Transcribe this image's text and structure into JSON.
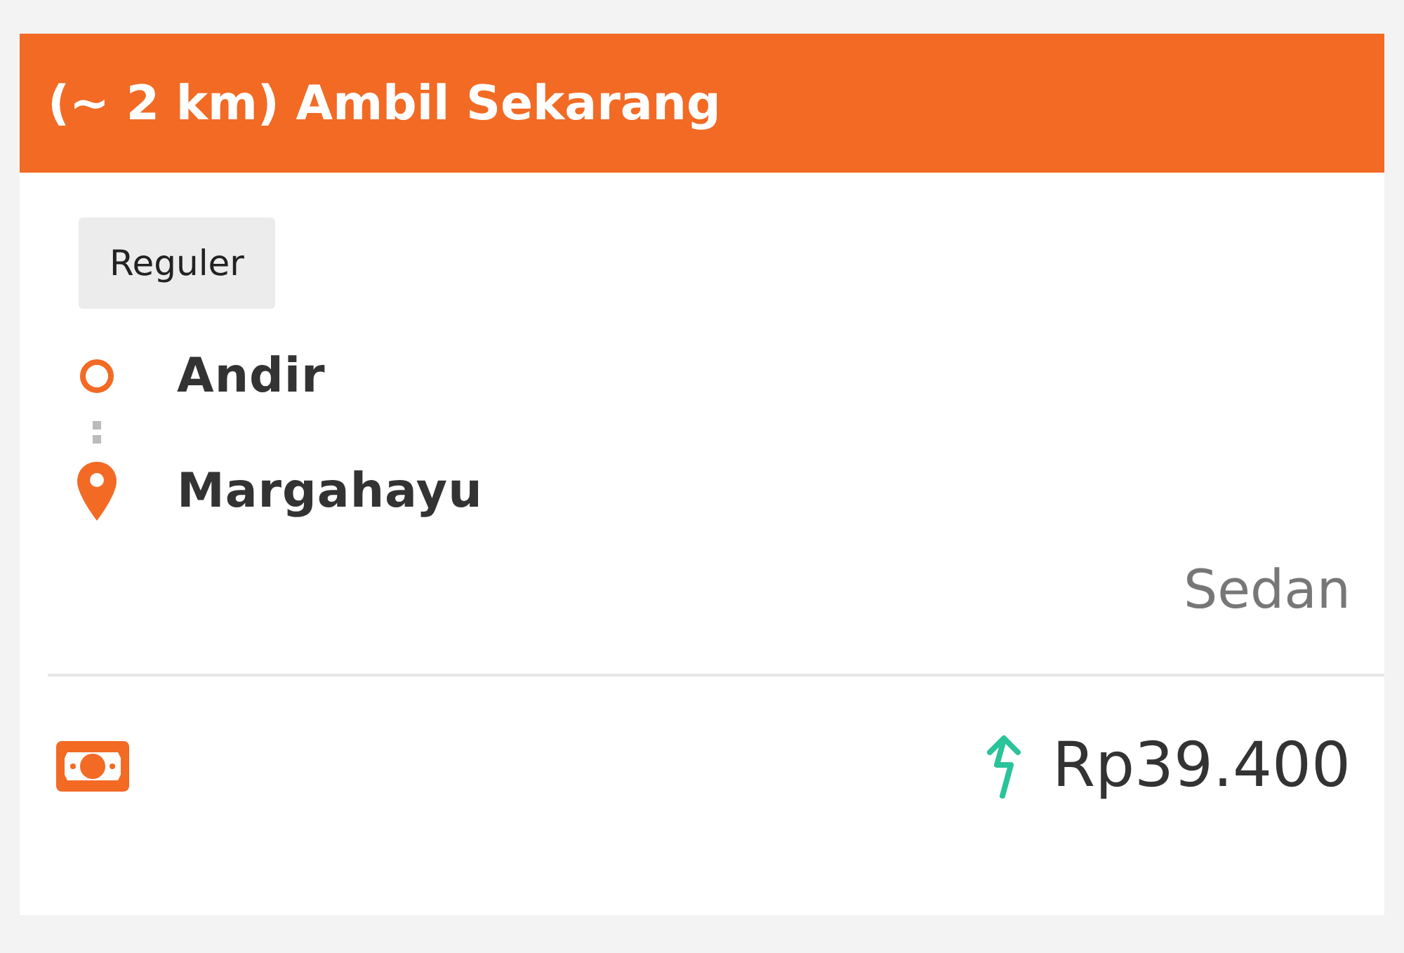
{
  "header": {
    "title": "(~ 2 km) Ambil Sekarang"
  },
  "service_tag": "Reguler",
  "route": [
    {
      "kind": "origin",
      "place": "Andir"
    },
    {
      "kind": "destination",
      "place": "Margahayu"
    }
  ],
  "vehicle_type": "Sedan",
  "fare": {
    "price": "Rp39.400"
  }
}
